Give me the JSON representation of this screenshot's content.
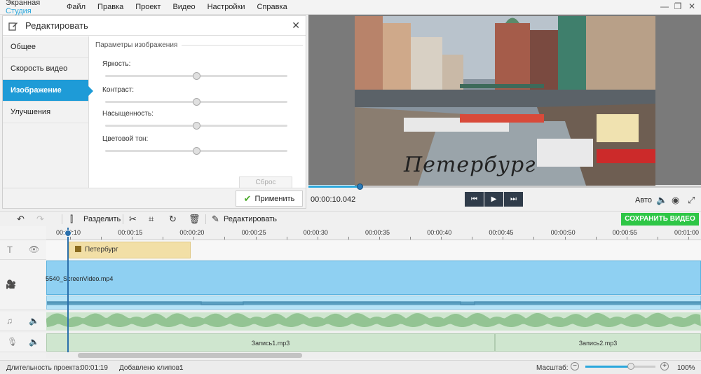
{
  "app": {
    "brand_part1": "Экранная",
    "brand_part2": "Студия"
  },
  "menu": [
    "Файл",
    "Правка",
    "Проект",
    "Видео",
    "Настройки",
    "Справка"
  ],
  "window_controls": {
    "minimize": "—",
    "maximize": "❐",
    "close": "✕"
  },
  "edit_panel": {
    "title": "Редактировать",
    "close_icon": "✕",
    "nav": [
      "Общее",
      "Скорость видео",
      "Изображение",
      "Улучшения"
    ],
    "active_nav": 2,
    "section_title": "Параметры изображения",
    "sliders": [
      {
        "label": "Яркость:",
        "value": 0.5
      },
      {
        "label": "Контраст:",
        "value": 0.5
      },
      {
        "label": "Насыщенность:",
        "value": 0.5
      },
      {
        "label": "Цветовой тон:",
        "value": 0.5
      }
    ],
    "reset_label": "Сброс",
    "apply_label": "Применить"
  },
  "preview": {
    "caption": "Петербург",
    "progress": 0.13,
    "timecode": "00:00:10.042",
    "buttons": {
      "prev": "skip-back-icon",
      "play": "play-icon",
      "next": "skip-forward-icon"
    },
    "auto_label": "Авто"
  },
  "toolbar": {
    "split_label": "Разделить",
    "edit_label": "Редактировать",
    "save_label": "СОХРАНИТЬ ВИДЕО"
  },
  "timeline": {
    "ruler_ticks": [
      "00:00:10",
      "00:00:15",
      "00:00:20",
      "00:00:25",
      "00:00:30",
      "00:00:35",
      "00:00:40",
      "00:00:45",
      "00:00:50",
      "00:00:55",
      "00:01:00"
    ],
    "title_clip": "Петербург",
    "video_clip": "5540_ScreenVideo.mp4",
    "recordings": [
      "Запись1.mp3",
      "Запись2.mp3"
    ]
  },
  "status": {
    "duration_label": "Длительность проекта:",
    "duration_value": "00:01:19",
    "clips_label": "Добавлено клипов:",
    "clips_value": "1",
    "zoom_label": "Масштаб:",
    "zoom_value": "100%",
    "zoom_level": 0.65
  },
  "colors": {
    "accent": "#2aa7dc",
    "save": "#2ec646",
    "transport": "#303c4a"
  }
}
